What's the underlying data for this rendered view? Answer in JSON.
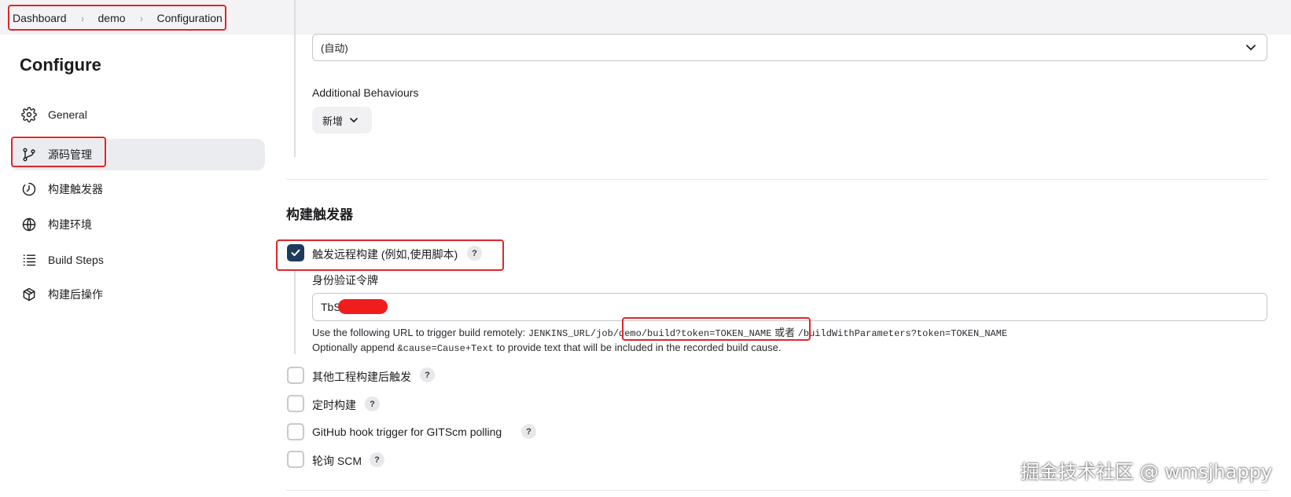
{
  "breadcrumb": {
    "items": [
      "Dashboard",
      "demo",
      "Configuration"
    ],
    "separator": "›"
  },
  "sidebar": {
    "title": "Configure",
    "items": [
      {
        "label": "General",
        "icon": "gear-icon"
      },
      {
        "label": "源码管理",
        "icon": "branch-icon"
      },
      {
        "label": "构建触发器",
        "icon": "clock-icon"
      },
      {
        "label": "构建环境",
        "icon": "globe-icon"
      },
      {
        "label": "Build Steps",
        "icon": "list-icon"
      },
      {
        "label": "构建后操作",
        "icon": "package-icon"
      }
    ],
    "active_index": 1
  },
  "scm": {
    "select_value": "(自动)",
    "additional_behaviours_label": "Additional Behaviours",
    "add_button_label": "新增"
  },
  "triggers": {
    "section_title": "构建触发器",
    "remote": {
      "label": "触发远程构建 (例如,使用脚本)",
      "checked": true,
      "token_label": "身份验证令牌",
      "token_value": "TbS",
      "help_line1_prefix": "Use the following URL to trigger build remotely: ",
      "help_line1_url1": "JENKINS_URL/job/demo/build?token=TOKEN_NAME",
      "help_line1_or": " 或者 ",
      "help_line1_url2": "/buildWithParameters?token=TOKEN_NAME",
      "help_line2_prefix": "Optionally append ",
      "help_line2_code": "&cause=Cause+Text",
      "help_line2_suffix": " to provide text that will be included in the recorded build cause."
    },
    "options": [
      {
        "label": "其他工程构建后触发",
        "checked": false
      },
      {
        "label": "定时构建",
        "checked": false
      },
      {
        "label": "GitHub hook trigger for GITScm polling",
        "checked": false
      },
      {
        "label": "轮询 SCM",
        "checked": false
      }
    ],
    "help_symbol": "?"
  },
  "watermark": "掘金技术社区 @ wmsjhappy",
  "colors": {
    "accent_checkbox": "#1d3a5c",
    "highlight_box": "#e0262b",
    "topbar_bg": "#f3f3f5",
    "active_nav_bg": "#ebecef"
  }
}
